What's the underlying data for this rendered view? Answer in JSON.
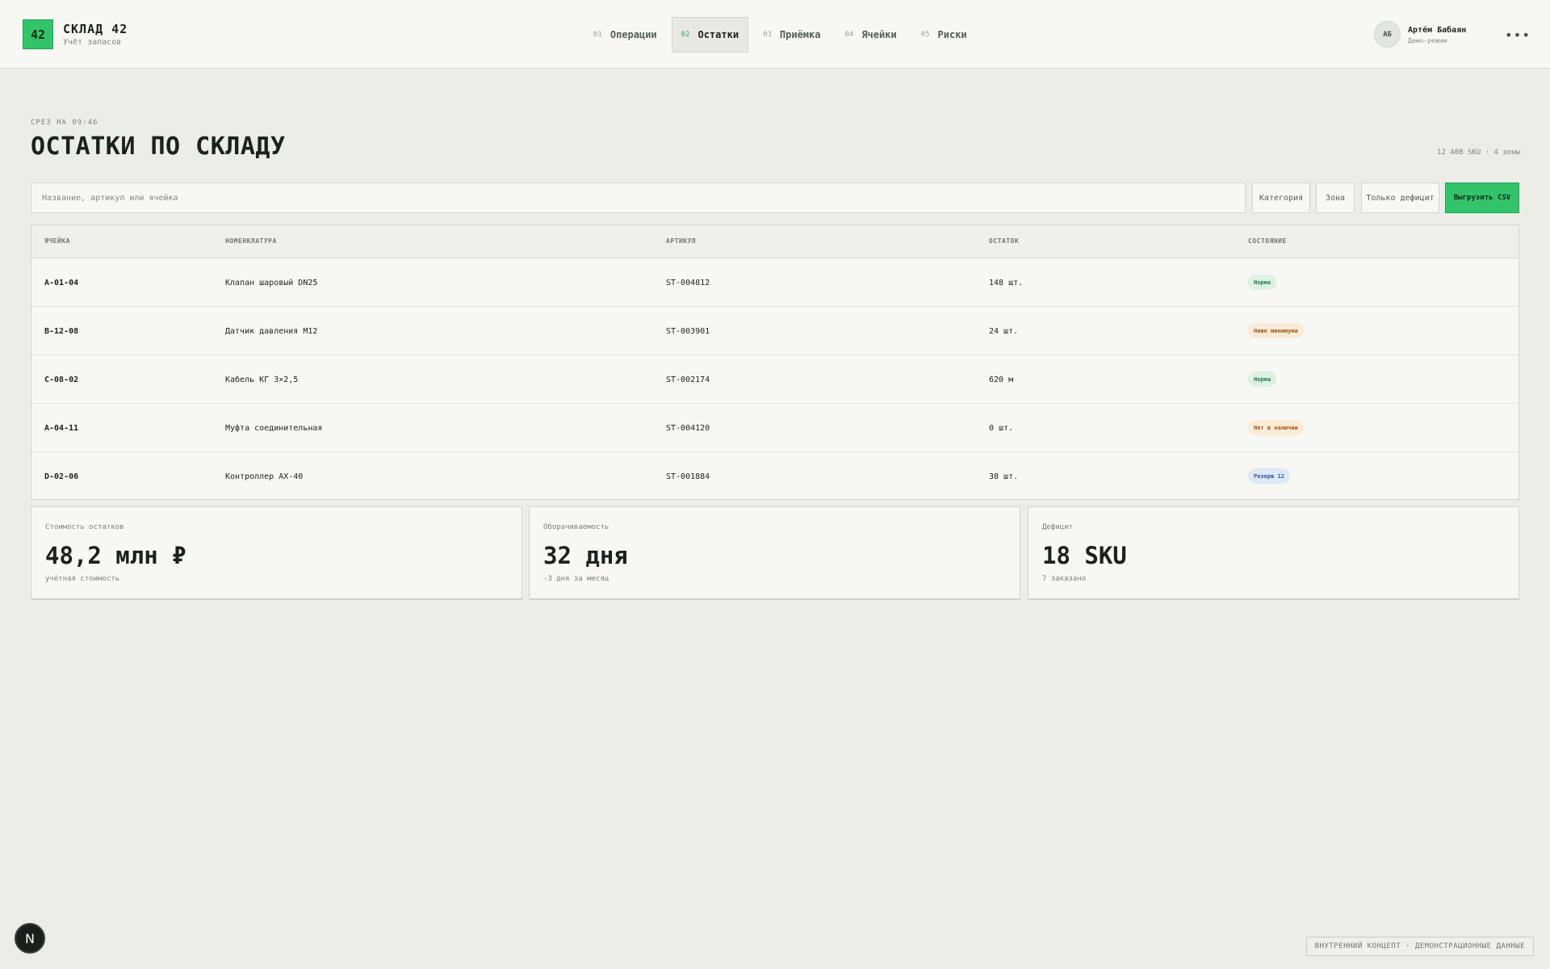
{
  "brand": {
    "badge": "42",
    "title": "СКЛАД 42",
    "subtitle": "Учёт запасов"
  },
  "nav": [
    {
      "num": "01",
      "label": "Операции"
    },
    {
      "num": "02",
      "label": "Остатки",
      "active": true
    },
    {
      "num": "03",
      "label": "Приёмка"
    },
    {
      "num": "04",
      "label": "Ячейки"
    },
    {
      "num": "05",
      "label": "Риски"
    }
  ],
  "user": {
    "initials": "АБ",
    "name": "Артём Бабаян",
    "mode": "Демо-режим",
    "more": "•••"
  },
  "page": {
    "eyebrow": "СРЕЗ НА 09:46",
    "title": "ОСТАТКИ ПО СКЛАДУ",
    "meta": "12 408 SKU · 4 зоны"
  },
  "toolbar": {
    "search_placeholder": "Название, артикул или ячейка",
    "category": "Категория",
    "zone": "Зона",
    "deficit_only": "Только дефицит",
    "export": "Выгрузить CSV"
  },
  "table": {
    "headers": [
      "ЯЧЕЙКА",
      "НОМЕНКЛАТУРА",
      "АРТИКУЛ",
      "ОСТАТОК",
      "СОСТОЯНИЕ"
    ],
    "rows": [
      {
        "cell": "A-01-04",
        "name": "Клапан шаровый DN25",
        "sku": "ST-004812",
        "qty": "148 шт.",
        "status": "Норма",
        "kind": "ok"
      },
      {
        "cell": "B-12-08",
        "name": "Датчик давления M12",
        "sku": "ST-003901",
        "qty": "24 шт.",
        "status": "Ниже минимума",
        "kind": "warn"
      },
      {
        "cell": "C-08-02",
        "name": "Кабель КГ 3×2,5",
        "sku": "ST-002174",
        "qty": "620 м",
        "status": "Норма",
        "kind": "ok"
      },
      {
        "cell": "A-04-11",
        "name": "Муфта соединительная",
        "sku": "ST-004120",
        "qty": "0 шт.",
        "status": "Нет в наличии",
        "kind": "warn"
      },
      {
        "cell": "D-02-06",
        "name": "Контроллер AX-40",
        "sku": "ST-001884",
        "qty": "38 шт.",
        "status": "Резерв 12",
        "kind": "info"
      }
    ]
  },
  "kpis": [
    {
      "label": "Стоимость остатков",
      "value": "48,2 млн ₽",
      "sub": "учётная стоимость"
    },
    {
      "label": "Оборачиваемость",
      "value": "32 дня",
      "sub": "-3 дня за месяц"
    },
    {
      "label": "Дефицит",
      "value": "18 SKU",
      "sub": "7 заказано"
    }
  ],
  "footer": {
    "fab": "N",
    "note": "ВНУТРЕННИЙ КОНЦЕПТ · ДЕМОНСТРАЦИОННЫЕ ДАННЫЕ"
  },
  "colors": {
    "accent": "#33c46b",
    "background": "#ecede8",
    "surface": "#f7f8f4"
  }
}
